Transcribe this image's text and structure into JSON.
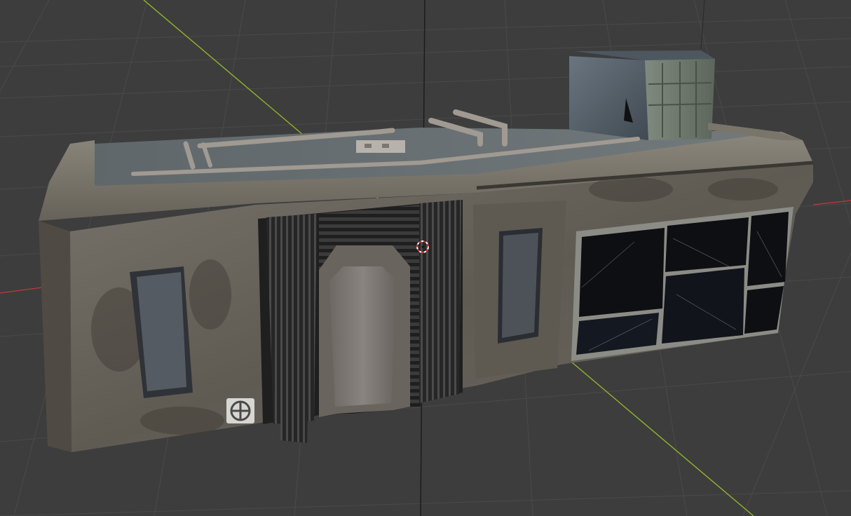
{
  "viewport": {
    "editor": "3D Viewport",
    "background": "#3d3d3d",
    "grid_color": "#4a4a4a",
    "x_axis_color": "#c0393b",
    "y_axis_color": "#8fb52a",
    "z_axis_color": "#1a1a1a"
  },
  "scene": {
    "object": "abandoned-building-model",
    "materials": {
      "concrete": "#6f6a60",
      "concrete_dark": "#4e4a42",
      "roof": "#5d6468",
      "metal_grate": "#2b2b2b",
      "glass": "#0d0f12",
      "window_frame": "#8c8c86",
      "door": "#7a7470",
      "ac_unit": "#5a6470"
    },
    "cursor": {
      "name": "3d-cursor",
      "color_a": "#d92f2f",
      "color_b": "#ffffff"
    }
  }
}
